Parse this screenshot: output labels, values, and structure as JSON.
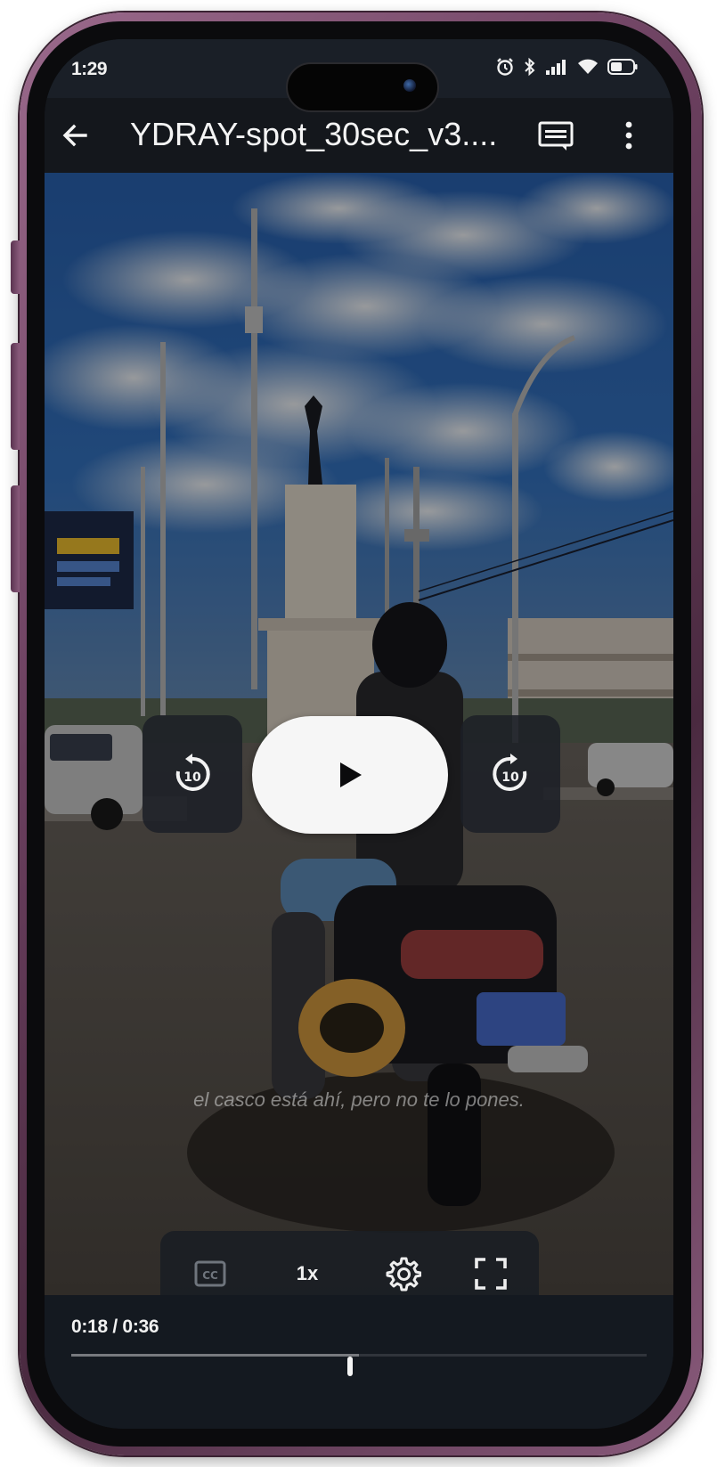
{
  "status_bar": {
    "time": "1:29",
    "icons": [
      "alarm-icon",
      "bluetooth-icon",
      "signal-icon",
      "wifi-icon",
      "battery-icon"
    ]
  },
  "header": {
    "title": "YDRAY-spot_30sec_v3....",
    "back_icon": "arrow-left-icon",
    "captions_icon": "captions-icon",
    "menu_icon": "more-vert-icon"
  },
  "player": {
    "rewind_icon": "replay-10-icon",
    "play_icon": "play-icon",
    "forward_icon": "forward-10-icon",
    "subtitle": "el casco está ahí, pero no te lo pones.",
    "speed_label": "1x",
    "cc_icon": "closed-caption-icon",
    "settings_icon": "gear-icon",
    "fullscreen_icon": "fullscreen-icon",
    "time_display": "0:18 / 0:36",
    "progress": 0.5
  },
  "colors": {
    "accent_light": "#f6f6f6",
    "bar_dark": "#141920"
  }
}
